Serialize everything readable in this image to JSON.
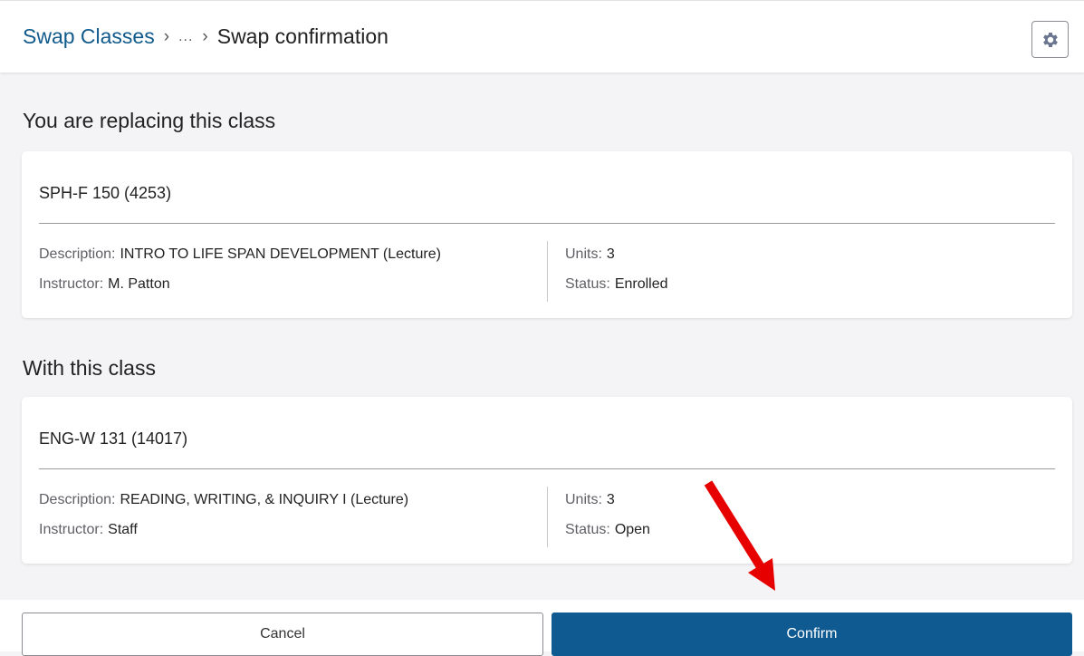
{
  "breadcrumb": {
    "root": "Swap Classes",
    "ellipsis": "...",
    "current": "Swap confirmation"
  },
  "settings_icon": "gear-icon",
  "replacing": {
    "heading": "You are replacing this class",
    "class_title": "SPH-F 150 (4253)",
    "description_label": "Description:",
    "description": "INTRO TO LIFE SPAN DEVELOPMENT (Lecture)",
    "instructor_label": "Instructor:",
    "instructor": "M. Patton",
    "units_label": "Units:",
    "units": "3",
    "status_label": "Status:",
    "status": "Enrolled"
  },
  "with": {
    "heading": "With this class",
    "class_title": "ENG-W 131 (14017)",
    "description_label": "Description:",
    "description": "READING, WRITING, & INQUIRY I (Lecture)",
    "instructor_label": "Instructor:",
    "instructor": "Staff",
    "units_label": "Units:",
    "units": "3",
    "status_label": "Status:",
    "status": "Open"
  },
  "actions": {
    "cancel_label": "Cancel",
    "confirm_label": "Confirm"
  },
  "annotation": {
    "type": "red-arrow",
    "color": "#e60000"
  },
  "colors": {
    "link": "#105a8c",
    "primary_button": "#0f5a91",
    "background": "#f4f4f6"
  }
}
